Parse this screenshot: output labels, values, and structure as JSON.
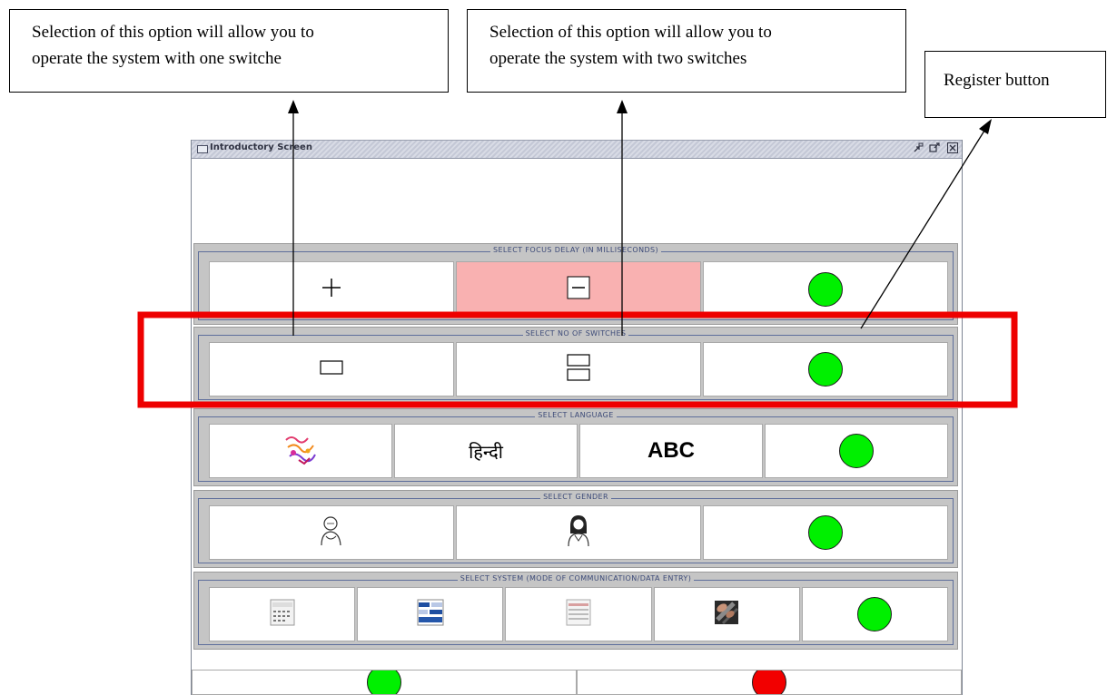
{
  "callouts": {
    "one_switch": {
      "line1": "Selection of this option will allow you to",
      "line2": "operate the system with one switche"
    },
    "two_switches": {
      "line1": "Selection of this option will allow you to",
      "line2": "operate the system with two switches"
    },
    "register": {
      "text": "Register button"
    }
  },
  "window": {
    "title": "Introductory Screen",
    "controls": {
      "minimize": "ⅆ",
      "maximize": "ⅆ",
      "close": "☒"
    }
  },
  "sections": {
    "focus_delay": {
      "label": "SELECT FOCUS DELAY (IN MILLISECONDS)",
      "increase_symbol": "+",
      "decrease_symbol": "−"
    },
    "switches": {
      "label": "SELECT NO OF SWITCHES"
    },
    "language": {
      "label": "SELECT LANGUAGE",
      "hindi": "हिन्दी",
      "english": "ABC"
    },
    "gender": {
      "label": "SELECT GENDER"
    },
    "system": {
      "label": "SELECT SYSTEM (MODE OF COMMUNICATION/DATA ENTRY)"
    }
  },
  "colors": {
    "register_dot": "#00f000",
    "cancel_dot": "#f20000",
    "highlight_box": "#ee0000",
    "selected_button": "#f9b1b1"
  },
  "icons": [
    "plus-icon",
    "minus-icon",
    "single-switch-icon",
    "double-switch-icon",
    "multilingual-icon",
    "male-user-icon",
    "female-user-icon",
    "keyboard-grid-icon",
    "blue-layout-icon",
    "text-table-icon",
    "typing-hands-icon"
  ]
}
